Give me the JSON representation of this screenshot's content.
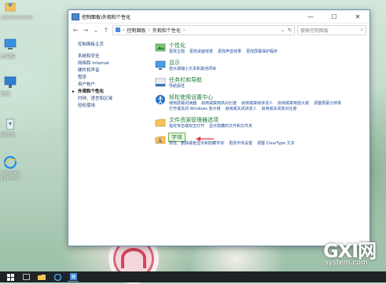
{
  "window": {
    "title": "控制面板\\外观和个性化",
    "minimize": "—",
    "maximize": "☐",
    "close": "✕"
  },
  "address": {
    "crumb1": "控制面板",
    "crumb2": "外观和个性化",
    "search_placeholder": "搜索控制面板"
  },
  "sidebar": {
    "home": "控制面板主页",
    "items": [
      "系统和安全",
      "网络和 Internet",
      "硬件和声音",
      "程序",
      "用户帐户",
      "外观和个性化",
      "时钟、语言和区域",
      "轻松使用"
    ]
  },
  "categories": [
    {
      "title": "个性化",
      "links": [
        "更改主题",
        "更改桌面背景",
        "更改声音效果",
        "更改屏幕保护程序"
      ],
      "icon": "personalization-icon"
    },
    {
      "title": "显示",
      "links": [
        "放大或缩小文本和其他项目"
      ],
      "icon": "display-icon"
    },
    {
      "title": "任务栏和导航",
      "links": [
        "导航属性"
      ],
      "icon": "taskbar-icon"
    },
    {
      "title": "轻松使用设置中心",
      "links": [
        "使用屏幕阅读器",
        "启用或禁用高对比度",
        "启用或禁用讲述人",
        "启用或禁用放大镜",
        "调整屏幕分辨率",
        "打开或关闭 Windows 放大镜",
        "启用或关闭讲述人",
        "启用或关闭高对比度"
      ],
      "icon": "ease-of-access-icon"
    },
    {
      "title": "文件资源管理器选项",
      "links": [
        "指定单击或双击打开",
        "显示隐藏的文件和文件夹"
      ],
      "icon": "folder-options-icon"
    },
    {
      "title": "字体",
      "links": [
        "预览、删除或者显示和隐藏字体",
        "更改字体设置",
        "调整 ClearType 文本"
      ],
      "icon": "fonts-icon"
    }
  ],
  "desktop_icons": [
    {
      "label": "Administrator"
    },
    {
      "label": "此电脑"
    },
    {
      "label": "网络"
    },
    {
      "label": "回收站"
    },
    {
      "label": "Internet Explorer"
    }
  ],
  "watermark": {
    "big": "GXI网",
    "small": "system.com"
  },
  "colors": {
    "accent": "#1e7a3c",
    "link": "#1e4c9a",
    "highlight": "#6fae3f",
    "arrow": "#e03a3a"
  }
}
